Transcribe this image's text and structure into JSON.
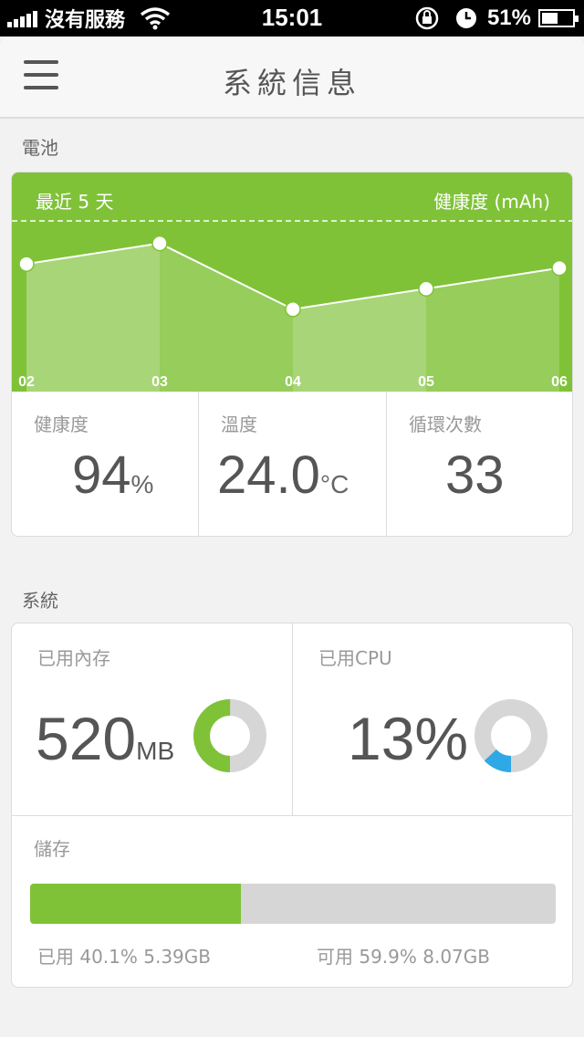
{
  "status_bar": {
    "carrier": "沒有服務",
    "time": "15:01",
    "battery_percent": "51%",
    "battery_level": 0.51
  },
  "header": {
    "title": "系統信息"
  },
  "battery_section": {
    "label": "電池",
    "chart_header_left": "最近 5 天",
    "chart_header_right": "健康度 (mAh)",
    "stats": [
      {
        "label": "健康度",
        "value": "94",
        "unit": "%"
      },
      {
        "label": "溫度",
        "value": "24.0",
        "unit": "°C"
      },
      {
        "label": "循環次數",
        "value": "33",
        "unit": ""
      }
    ]
  },
  "chart_data": {
    "type": "area",
    "title": "",
    "xlabel": "",
    "ylabel": "",
    "categories": [
      "02",
      "03",
      "04",
      "05",
      "06"
    ],
    "values": [
      62,
      72,
      40,
      50,
      60
    ],
    "ylim": [
      0,
      100
    ]
  },
  "system_section": {
    "label": "系統",
    "memory": {
      "label": "已用內存",
      "value": "520",
      "unit": "MB",
      "fraction": 0.5
    },
    "cpu": {
      "label": "已用CPU",
      "value": "13%",
      "fraction": 0.13
    },
    "storage": {
      "label": "儲存",
      "used_fraction": 0.401,
      "used_text": "已用 40.1% 5.39GB",
      "free_text": "可用 59.9% 8.07GB"
    }
  },
  "colors": {
    "accent_green": "#7fc238",
    "cpu_blue": "#2fa8e6",
    "donut_track": "#d6d6d6"
  }
}
